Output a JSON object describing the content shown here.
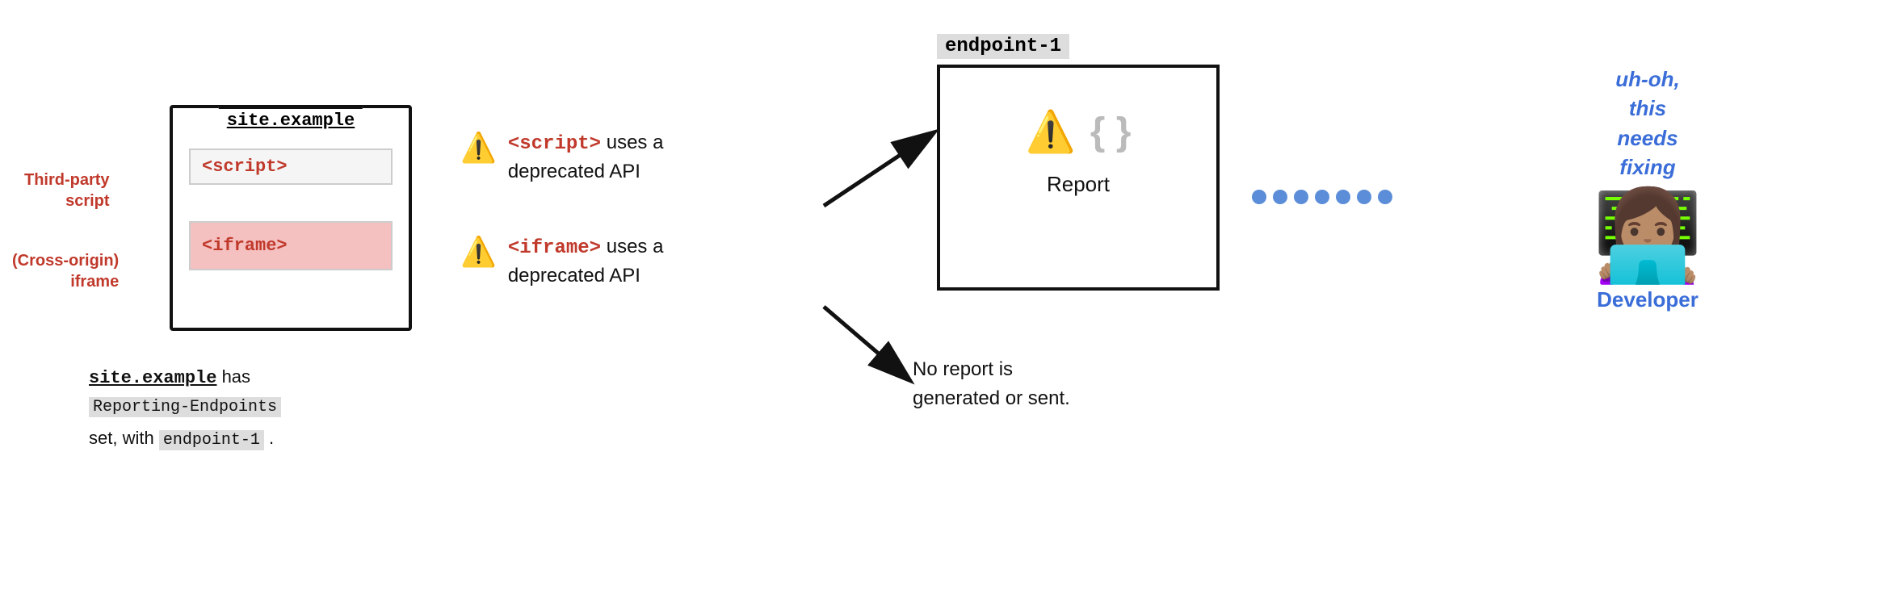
{
  "site_box": {
    "title": "site.example",
    "script_tag": "<script>",
    "iframe_tag": "<iframe>"
  },
  "left_labels": {
    "third_party": "Third-party\nscript",
    "cross_origin": "(Cross-origin)\niframe"
  },
  "bottom_text": {
    "line1_mono": "site.example",
    "line1_rest": " has",
    "line2_mono": "Reporting-Endpoints",
    "line3_rest": "set, with",
    "line3_endpoint": "endpoint-1",
    "line3_end": "."
  },
  "warnings": [
    {
      "icon": "⚠️",
      "tag": "<script>",
      "text": " uses a\ndeprecated API"
    },
    {
      "icon": "⚠️",
      "tag": "<iframe>",
      "text": " uses a\ndeprecated API"
    }
  ],
  "endpoint": {
    "label": "endpoint-1",
    "warn_icon": "⚠️",
    "braces": "{ }",
    "report_label": "Report"
  },
  "no_report": {
    "text": "No report is\ngenerated or sent."
  },
  "dots": [
    "•",
    "•",
    "•",
    "•",
    "•",
    "•"
  ],
  "developer": {
    "speech": "uh-oh,\nthis\nneeds\nfixing",
    "emoji": "👩🏽‍💻",
    "label": "Developer"
  }
}
